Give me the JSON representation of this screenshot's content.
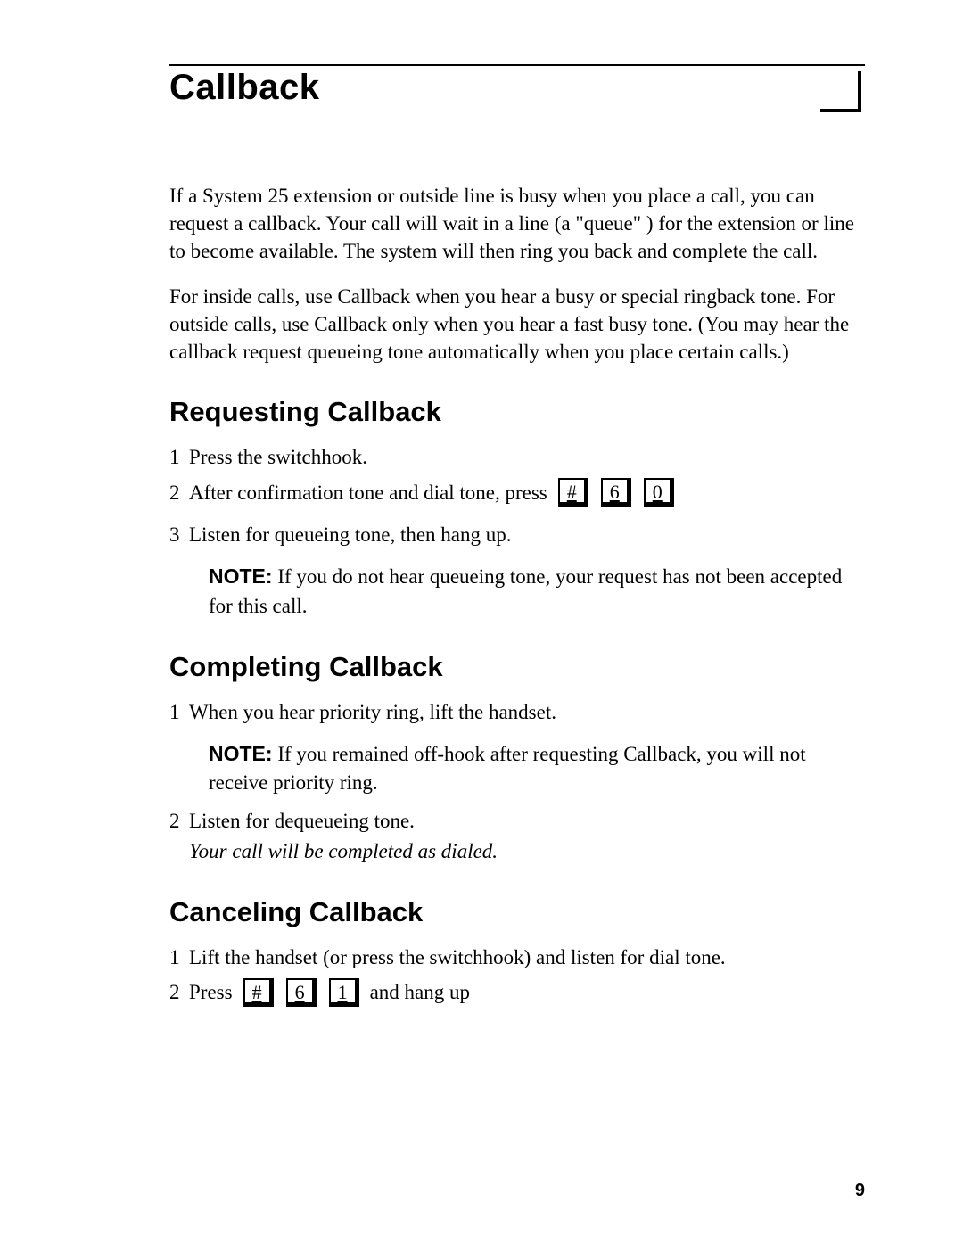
{
  "title": "Callback",
  "intro_p1": "If a System 25 extension or outside line is busy when you place a call, you can request a callback. Your call will wait in a line (a \"queue\" ) for the extension or line to become available. The system will then ring you back and complete the call.",
  "intro_p2": "For inside calls, use Callback when you hear a busy or special ringback tone.   For outside calls, use Callback only when you hear a fast busy tone. (You may hear the callback request queueing tone automatically when you place certain calls.)",
  "sections": {
    "requesting": {
      "heading": "Requesting Callback",
      "step1": "Press  the  switchhook.",
      "step2": "After confirmation tone and dial tone, press",
      "step2_keys": [
        "#",
        "6",
        "0"
      ],
      "step3": "Listen for queueing tone, then hang up.",
      "note_label": "NOTE:",
      "note_text": " If you do not hear queueing tone, your request has not been accepted for this call."
    },
    "completing": {
      "heading": "Completing Callback",
      "step1": "When you hear priority ring, lift the handset.",
      "note_label": "NOTE:",
      "note_text": " If you remained off-hook after requesting Callback, you will not receive priority ring.",
      "step2": "Listen for dequeueing tone.",
      "step2_sub": "Your call will be completed as dialed."
    },
    "canceling": {
      "heading": "Canceling Callback",
      "step1": "Lift the handset (or press the switchhook) and listen for dial tone.",
      "step2_pre": "Press",
      "step2_keys": [
        "#",
        "6",
        "1"
      ],
      "step2_post": "and hang up"
    }
  },
  "page_number": "9"
}
